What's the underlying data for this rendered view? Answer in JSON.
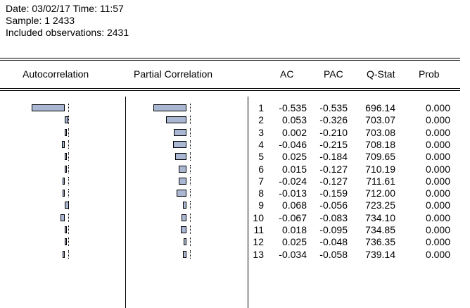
{
  "header": {
    "date_line": "Date: 03/02/17   Time: 11:57",
    "sample_line": "Sample: 1 2433",
    "obs_line": "Included observations: 2431"
  },
  "columns": {
    "autocorrelation": "Autocorrelation",
    "partial_correlation": "Partial Correlation",
    "ac": "AC",
    "pac": "PAC",
    "qstat": "Q-Stat",
    "prob": "Prob"
  },
  "rows": [
    {
      "lag": "1",
      "ac": "-0.535",
      "pac": "-0.535",
      "q": "696.14",
      "prob": "0.000"
    },
    {
      "lag": "2",
      "ac": "0.053",
      "pac": "-0.326",
      "q": "703.07",
      "prob": "0.000"
    },
    {
      "lag": "3",
      "ac": "0.002",
      "pac": "-0.210",
      "q": "703.08",
      "prob": "0.000"
    },
    {
      "lag": "4",
      "ac": "-0.046",
      "pac": "-0.215",
      "q": "708.18",
      "prob": "0.000"
    },
    {
      "lag": "5",
      "ac": "0.025",
      "pac": "-0.184",
      "q": "709.65",
      "prob": "0.000"
    },
    {
      "lag": "6",
      "ac": "0.015",
      "pac": "-0.127",
      "q": "710.19",
      "prob": "0.000"
    },
    {
      "lag": "7",
      "ac": "-0.024",
      "pac": "-0.127",
      "q": "711.61",
      "prob": "0.000"
    },
    {
      "lag": "8",
      "ac": "-0.013",
      "pac": "-0.159",
      "q": "712.00",
      "prob": "0.000"
    },
    {
      "lag": "9",
      "ac": "0.068",
      "pac": "-0.056",
      "q": "723.25",
      "prob": "0.000"
    },
    {
      "lag": "10",
      "ac": "-0.067",
      "pac": "-0.083",
      "q": "734.10",
      "prob": "0.000"
    },
    {
      "lag": "11",
      "ac": "0.018",
      "pac": "-0.095",
      "q": "734.85",
      "prob": "0.000"
    },
    {
      "lag": "12",
      "ac": "0.025",
      "pac": "-0.048",
      "q": "736.35",
      "prob": "0.000"
    },
    {
      "lag": "13",
      "ac": "-0.034",
      "pac": "-0.058",
      "q": "739.14",
      "prob": "0.000"
    }
  ],
  "colors": {
    "bar_fill": "#aab7d2"
  }
}
